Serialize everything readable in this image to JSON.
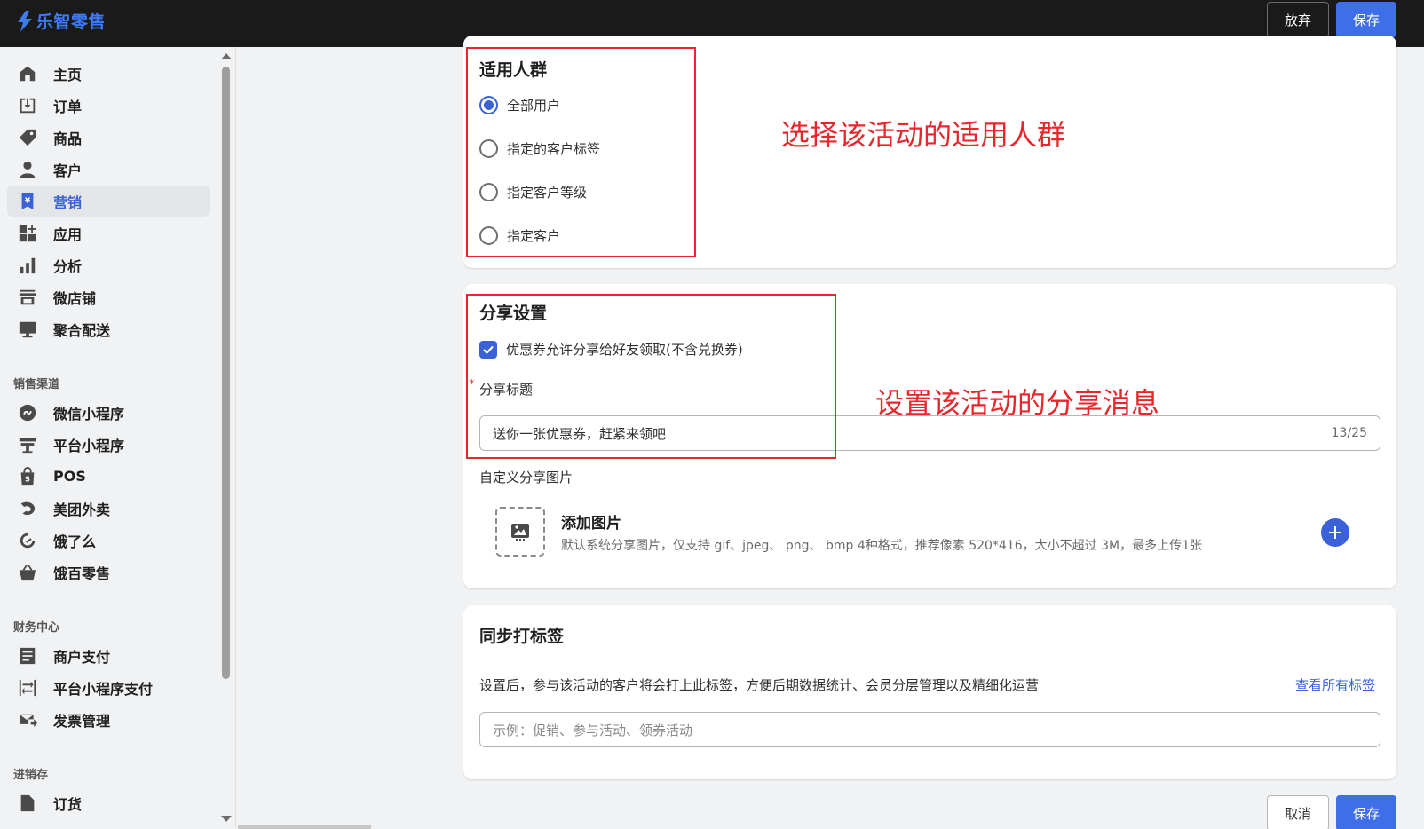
{
  "app": {
    "name": "乐智零售"
  },
  "topbar": {
    "discard_label": "放弃",
    "save_label": "保存"
  },
  "sidebar": {
    "main_items": [
      {
        "label": "主页",
        "icon": "home-icon"
      },
      {
        "label": "订单",
        "icon": "order-inbox-icon"
      },
      {
        "label": "商品",
        "icon": "tag-icon"
      },
      {
        "label": "客户",
        "icon": "person-icon"
      },
      {
        "label": "营销",
        "icon": "yen-bookmark-icon",
        "active": true
      },
      {
        "label": "应用",
        "icon": "apps-grid-icon"
      },
      {
        "label": "分析",
        "icon": "bar-chart-icon"
      },
      {
        "label": "微店铺",
        "icon": "storefront-icon"
      },
      {
        "label": "聚合配送",
        "icon": "monitor-icon"
      }
    ],
    "sales_channels": {
      "title": "销售渠道",
      "items": [
        {
          "label": "微信小程序",
          "icon": "mini-program-icon"
        },
        {
          "label": "平台小程序",
          "icon": "platform-icon"
        },
        {
          "label": "POS",
          "icon": "shopping-bag-icon"
        },
        {
          "label": "美团外卖",
          "icon": "meituan-icon"
        },
        {
          "label": "饿了么",
          "icon": "eleme-icon"
        },
        {
          "label": "饿百零售",
          "icon": "basket-icon"
        }
      ]
    },
    "finance": {
      "title": "财务中心",
      "items": [
        {
          "label": "商户支付",
          "icon": "receipt-icon"
        },
        {
          "label": "平台小程序支付",
          "icon": "transfer-icon"
        },
        {
          "label": "发票管理",
          "icon": "invoice-mail-icon"
        }
      ]
    },
    "inventory": {
      "title": "进销存",
      "items": [
        {
          "label": "订货",
          "icon": "document-icon"
        }
      ]
    }
  },
  "audience": {
    "title": "适用人群",
    "options": [
      {
        "label": "全部用户",
        "checked": true
      },
      {
        "label": "指定的客户标签",
        "checked": false
      },
      {
        "label": "指定客户等级",
        "checked": false
      },
      {
        "label": "指定客户",
        "checked": false
      }
    ]
  },
  "share": {
    "title": "分享设置",
    "allow_share_label": "优惠券允许分享给好友领取(不含兑换券)",
    "allow_share_checked": true,
    "title_field_label": "分享标题",
    "required_mark": "*",
    "title_value": "送你一张优惠券，赶紧来领吧",
    "title_counter": "13/25",
    "custom_image_label": "自定义分享图片",
    "add_image_title": "添加图片",
    "add_image_hint": "默认系统分享图片，仅支持 gif、jpeg、 png、 bmp 4种格式，推荐像素 520*416，大小不超过 3M，最多上传1张"
  },
  "tags": {
    "title": "同步打标签",
    "description": "设置后，参与该活动的客户将会打上此标签，方便后期数据统计、会员分层管理以及精细化运营",
    "view_all_link": "查看所有标签",
    "input_placeholder": "示例：促销、参与活动、领券活动"
  },
  "annotations": {
    "audience_note": "选择该活动的适用人群",
    "share_note": "设置该活动的分享消息",
    "color": "#e8262c"
  },
  "footer": {
    "cancel_label": "取消",
    "save_label": "保存"
  },
  "colors": {
    "accent": "#3a62d6",
    "topbar": "#1a1a1a"
  }
}
